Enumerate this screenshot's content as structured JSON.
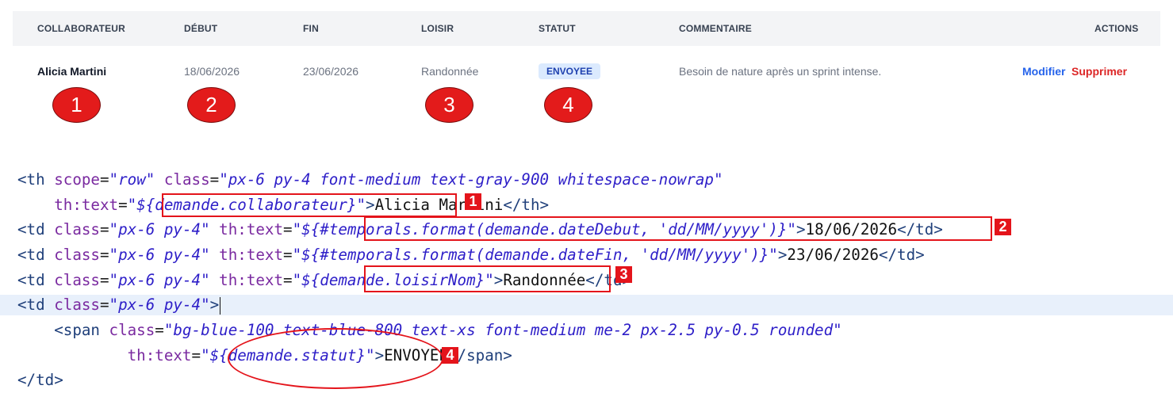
{
  "table": {
    "headers": [
      "COLLABORATEUR",
      "DÉBUT",
      "FIN",
      "LOISIR",
      "STATUT",
      "COMMENTAIRE",
      "ACTIONS"
    ],
    "row": {
      "collaborateur": "Alicia Martini",
      "debut": "18/06/2026",
      "fin": "23/06/2026",
      "loisir": "Randonnée",
      "statut": "ENVOYEE",
      "commentaire": "Besoin de nature après un sprint intense.",
      "modifier": "Modifier",
      "supprimer": "Supprimer"
    }
  },
  "markers": [
    "1",
    "2",
    "3",
    "4"
  ],
  "code": {
    "l1_open": "<th ",
    "l1_a1": "scope",
    "l1_v1": "\"row\"",
    "l1_a2": " class",
    "l1_v2": "\"px-6 py-4 font-medium text-gray-900 whitespace-nowrap\"",
    "l2_a": "th:text",
    "l2_v": "\"${demande.collaborateur}\"",
    "l2_gt": ">",
    "l2_t": "Alicia Martini",
    "l2_close": "</th>",
    "l3_open": "<td ",
    "l3_a1": "class",
    "l3_v1": "\"px-6 py-4\"",
    "l3_a2": " th:text",
    "l3_v2": "\"${#temporals.format(demande.dateDebut, 'dd/MM/yyyy')}\"",
    "l3_gt": ">",
    "l3_t": "18/06/2026",
    "l3_close": "</td>",
    "l4_open": "<td ",
    "l4_a1": "class",
    "l4_v1": "\"px-6 py-4\"",
    "l4_a2": " th:text",
    "l4_v2": "\"${#temporals.format(demande.dateFin, 'dd/MM/yyyy')}\"",
    "l4_gt": ">",
    "l4_t": "23/06/2026",
    "l4_close": "</td>",
    "l5_open": "<td ",
    "l5_a1": "class",
    "l5_v1": "\"px-6 py-4\"",
    "l5_a2": " th:text",
    "l5_v2": "\"${demande.loisirNom}\"",
    "l5_gt": ">",
    "l5_t": "Randonnée",
    "l5_close": "</td>",
    "l6_open": "<td ",
    "l6_a1": "class",
    "l6_v1": "\"px-6 py-4\"",
    "l6_gt": ">",
    "l7_open": "<span ",
    "l7_a1": "class",
    "l7_v1": "\"bg-blue-100 text-blue-800 text-xs font-medium me-2 px-2.5 py-0.5 rounded\"",
    "l8_a": "th:text",
    "l8_v": "\"${demande.statut}\"",
    "l8_gt": ">",
    "l8_t": "ENVOYEE",
    "l8_close": "</span>",
    "l9_close": "</td>"
  },
  "colors": {
    "accent_red": "#e4141b",
    "badge_bg": "#dbeafe",
    "badge_text": "#1e40af",
    "link_blue": "#2563eb",
    "link_red": "#dc2626"
  }
}
